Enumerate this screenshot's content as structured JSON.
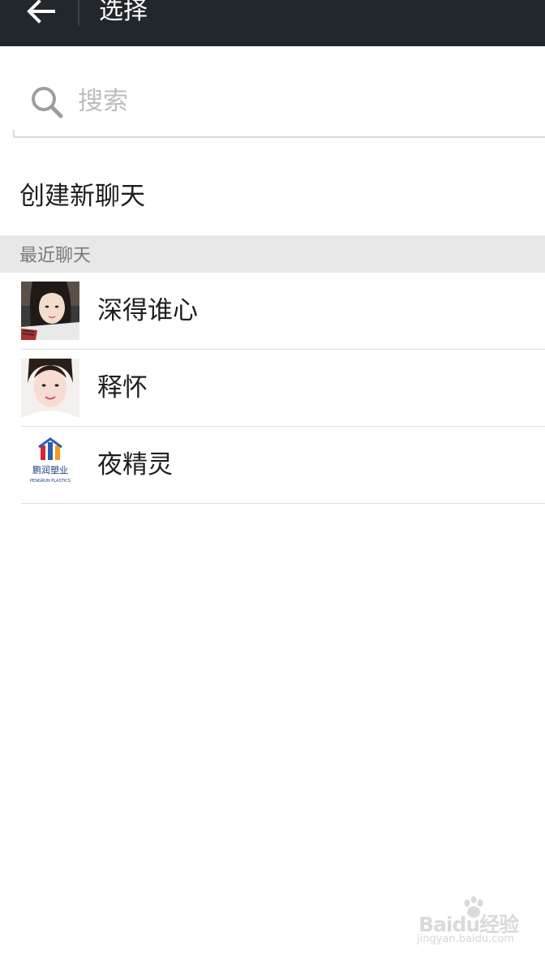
{
  "header": {
    "title": "选择"
  },
  "search": {
    "placeholder": "搜索",
    "value": ""
  },
  "create_chat": {
    "label": "创建新聊天"
  },
  "recent": {
    "header": "最近聊天",
    "contacts": [
      {
        "name": "深得谁心"
      },
      {
        "name": "释怀"
      },
      {
        "name": "夜精灵",
        "avatar_text": "鹏润塑业",
        "avatar_subtext": "PENGRUN PLASTICS"
      }
    ]
  },
  "watermark": {
    "logo_text": "Baidu经验",
    "url": "jingyan.baidu.com"
  },
  "colors": {
    "topbar": "#22272b",
    "section_bg": "#e8e8e8",
    "text_primary": "#1e1e1e",
    "text_secondary": "#7a7a7a"
  }
}
